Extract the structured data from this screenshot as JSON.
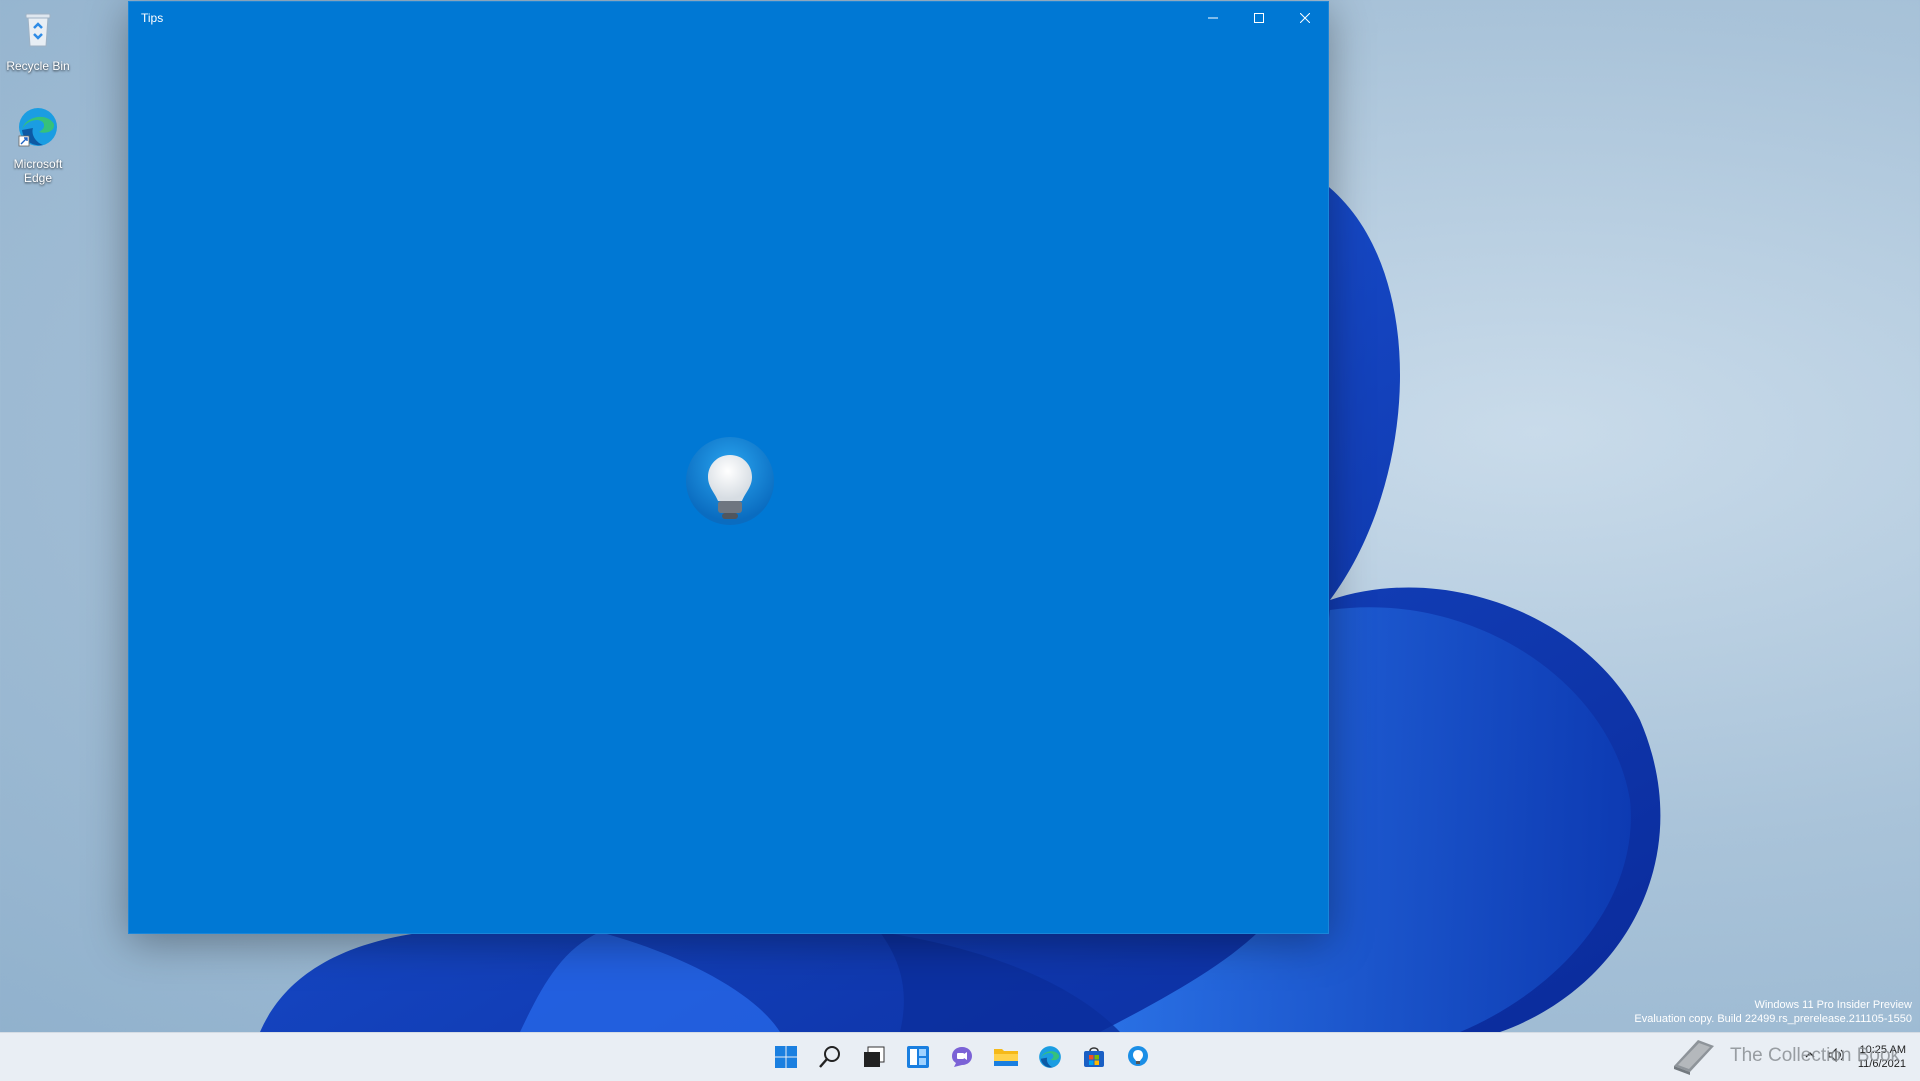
{
  "desktop": {
    "icons": [
      {
        "label": "Recycle Bin"
      },
      {
        "label": "Microsoft Edge"
      }
    ]
  },
  "window": {
    "title": "Tips",
    "background_color": "#0078d4",
    "splash_icon": "lightbulb-icon"
  },
  "eval_watermark": {
    "line1": "Windows 11 Pro Insider Preview",
    "line2": "Evaluation copy. Build 22499.rs_prerelease.211105-1550"
  },
  "taskbar": {
    "apps": [
      "start-icon",
      "search-icon",
      "task-view-icon",
      "widgets-icon",
      "chat-icon",
      "file-explorer-icon",
      "edge-icon",
      "store-icon",
      "tips-icon"
    ],
    "clock": {
      "time": "10:25 AM",
      "date": "11/6/2021"
    }
  },
  "overlay_watermark": {
    "text": "The Collection Book"
  }
}
